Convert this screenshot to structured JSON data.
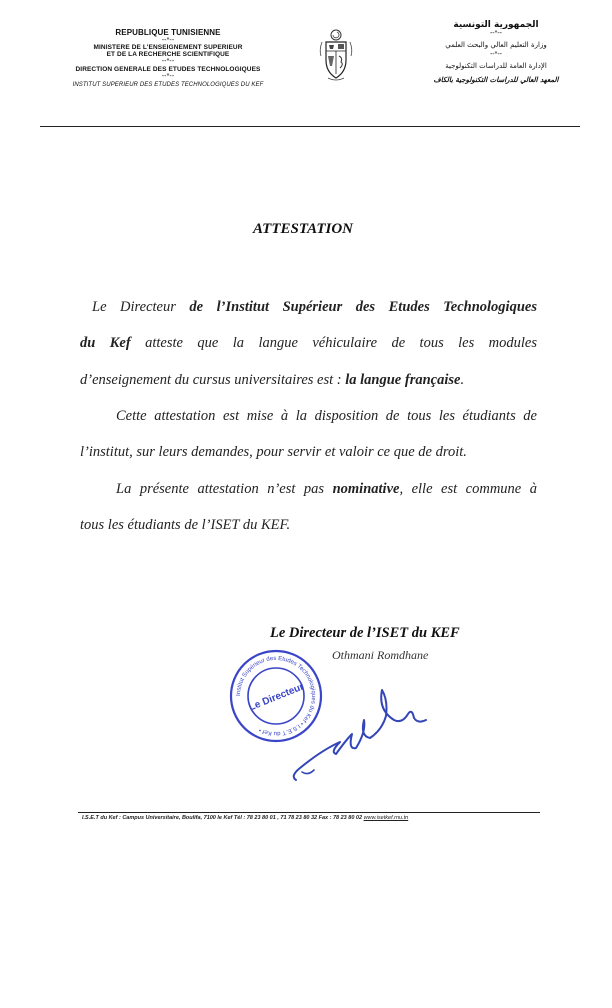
{
  "header": {
    "fr": {
      "republic": "REPUBLIQUE TUNISIENNE",
      "sep1": "--*--",
      "ministry_1": "MINISTERE DE L'ENSEIGNEMENT SUPERIEUR",
      "ministry_2": "ET DE LA RECHERCHE SCIENTIFIQUE",
      "sep2": "--*--",
      "direction": "DIRECTION GENERALE DES ETUDES TECHNOLOGIQUES",
      "sep3": "--*--",
      "institute": "INSTITUT SUPERIEUR DES ETUDES TECHNOLOGIQUES DU KEF"
    },
    "ar": {
      "republic": "الجمهورية التونسية",
      "sep1": "--*--",
      "ministry": "وزارة التعليم العالي والبحث العلمي",
      "sep2": "--*--",
      "direction": "الإدارة العامة للدراسات التكنولوجية",
      "institute": "المعهد العالي للدراسات التكنولوجية بالكاف"
    },
    "emblem": "tunisia-coat-of-arms-icon"
  },
  "title": "ATTESTATION",
  "body": {
    "p1_l1_a": "Le Directeur ",
    "p1_l1_b": "de l’Institut Supérieur des Etudes Technologiques",
    "p1_l2_a": "du Kef",
    "p1_l2_b": " atteste que la langue véhiculaire de tous les modules",
    "p1_l3_a": "d’enseignement du cursus universitaires est : ",
    "p1_l3_b": "la langue française",
    "p1_l3_c": ".",
    "p2_l1": "Cette attestation est mise à la disposition de tous les étudiants de",
    "p2_l2": "l’institut, sur leurs demandes, pour servir et valoir ce que de droit.",
    "p3_l1_a": "La présente attestation n’est pas ",
    "p3_l1_b": "nominative",
    "p3_l1_c": ", elle est commune à",
    "p3_l2": "tous les étudiants de l’ISET du KEF."
  },
  "signature": {
    "title": "Le Directeur de l’ISET du KEF",
    "name": "Othmani Romdhane",
    "stamp_center": "Le Directeur",
    "stamp_ring": "Institut Supérieur des Etudes Technologiques du Kef • I.S.E.T du Kef •",
    "stamp_color": "#3a45c8",
    "ink_color": "#3346b8"
  },
  "footer": {
    "address": "I.S.E.T du Kef : Campus Universitaire, Boulifa, 7100 le Kef",
    "phone": "Tél : 78 23 80 01 ,  71 78 23 80 32 Fax : 78 23 80 02",
    "website": "www.isetkef.rnu.tn"
  }
}
